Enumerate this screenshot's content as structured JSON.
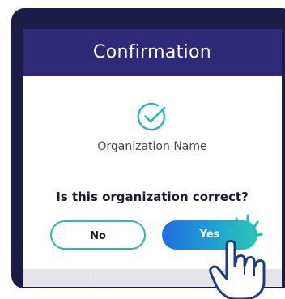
{
  "dialog": {
    "title": "Confirmation",
    "organization_name": "Organization Name",
    "question": "Is this organization correct?",
    "no_label": "No",
    "yes_label": "Yes"
  },
  "icons": {
    "check": "check-circle-icon",
    "hand": "pointing-hand-icon"
  },
  "colors": {
    "header": "#2e2a78",
    "frame": "#1d1c47",
    "accent": "#2bb8ad",
    "yes_gradient_start": "#1f6fe0",
    "yes_gradient_end": "#27c7b4"
  }
}
